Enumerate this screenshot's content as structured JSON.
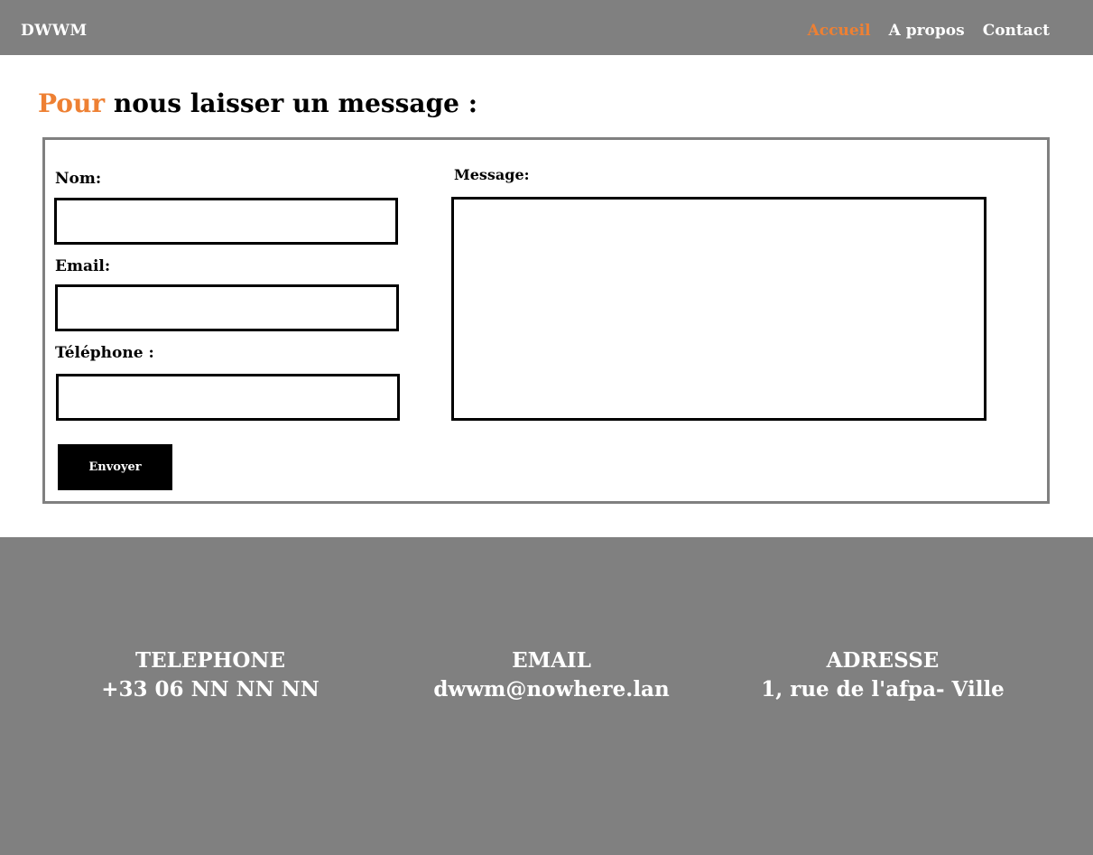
{
  "header": {
    "brand": "DWWM",
    "nav": [
      {
        "label": "Accueil",
        "active": true
      },
      {
        "label": "A propos",
        "active": false
      },
      {
        "label": "Contact",
        "active": false
      }
    ]
  },
  "page": {
    "title_accent": "Pour",
    "title_rest": " nous laisser un message :"
  },
  "form": {
    "name_label": "Nom:",
    "name_value": "",
    "email_label": "Email:",
    "email_value": "",
    "phone_label": "Téléphone :",
    "phone_value": "",
    "message_label": "Message:",
    "message_value": "",
    "submit_label": "Envoyer"
  },
  "footer": {
    "phone_title": "TELEPHONE",
    "phone_value": "+33 06 NN NN NN",
    "email_title": "EMAIL",
    "email_value": "dwwm@nowhere.lan",
    "address_title": "ADRESSE",
    "address_value": "1, rue de l'afpa- Ville"
  },
  "colors": {
    "bar_gray": "#808080",
    "accent_orange": "#ee8033",
    "button_black": "#000000",
    "white": "#ffffff"
  }
}
